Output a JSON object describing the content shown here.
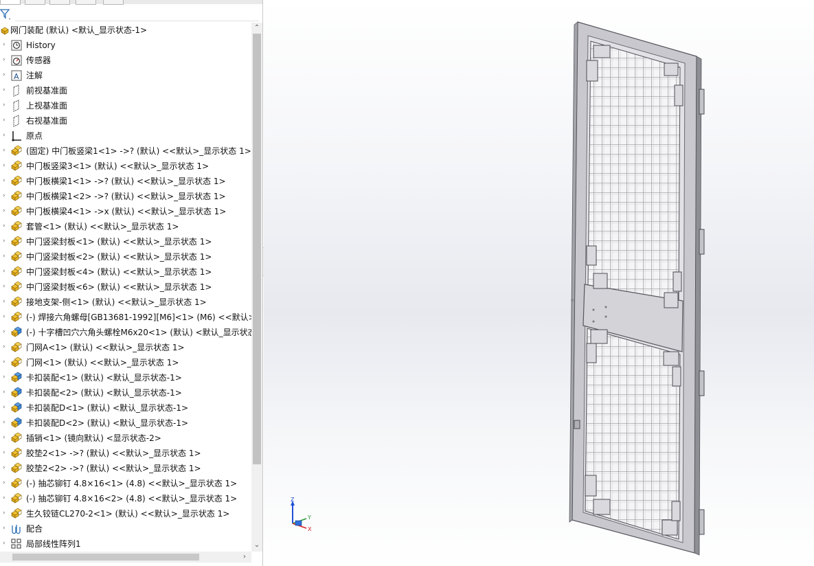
{
  "feature_tree": {
    "root_label": "网门装配 (默认) <默认_显示状态-1>",
    "items": [
      {
        "label": "History",
        "icon": "history-icon"
      },
      {
        "label": "传感器",
        "icon": "sensor-icon"
      },
      {
        "label": "注解",
        "icon": "annotation-icon"
      },
      {
        "label": "前视基准面",
        "icon": "plane-icon"
      },
      {
        "label": "上视基准面",
        "icon": "plane-icon"
      },
      {
        "label": "右视基准面",
        "icon": "plane-icon"
      },
      {
        "label": "原点",
        "icon": "origin-icon"
      },
      {
        "label": "(固定) 中门板竖梁1<1> ->? (默认) <<默认>_显示状态 1>",
        "icon": "part-icon"
      },
      {
        "label": "中门板竖梁3<1> (默认) <<默认>_显示状态 1>",
        "icon": "part-icon"
      },
      {
        "label": "中门板横梁1<1> ->? (默认) <<默认>_显示状态 1>",
        "icon": "part-icon"
      },
      {
        "label": "中门板横梁1<2> ->? (默认) <<默认>_显示状态 1>",
        "icon": "part-icon"
      },
      {
        "label": "中门板横梁4<1> ->x (默认) <<默认>_显示状态 1>",
        "icon": "part-icon"
      },
      {
        "label": "套管<1> (默认) <<默认>_显示状态 1>",
        "icon": "part-icon"
      },
      {
        "label": "中门竖梁封板<1> (默认) <<默认>_显示状态 1>",
        "icon": "part-icon"
      },
      {
        "label": "中门竖梁封板<2> (默认) <<默认>_显示状态 1>",
        "icon": "part-icon"
      },
      {
        "label": "中门竖梁封板<4> (默认) <<默认>_显示状态 1>",
        "icon": "part-icon"
      },
      {
        "label": "中门竖梁封板<6> (默认) <<默认>_显示状态 1>",
        "icon": "part-icon"
      },
      {
        "label": "接地支架-侧<1> (默认) <<默认>_显示状态 1>",
        "icon": "part-icon"
      },
      {
        "label": "(-) 焊接六角螺母[GB13681-1992][M6]<1> (M6) <<默认>",
        "icon": "part-icon"
      },
      {
        "label": "(-) 十字槽凹穴六角头螺栓M6x20<1> (默认) <默认_显示状态",
        "icon": "subassembly-icon"
      },
      {
        "label": "门网A<1> (默认) <<默认>_显示状态 1>",
        "icon": "part-icon"
      },
      {
        "label": "门网<1> (默认) <<默认>_显示状态 1>",
        "icon": "part-icon"
      },
      {
        "label": "卡扣装配<1> (默认) <默认_显示状态-1>",
        "icon": "subassembly-icon"
      },
      {
        "label": "卡扣装配<2> (默认) <默认_显示状态-1>",
        "icon": "subassembly-icon"
      },
      {
        "label": "卡扣装配D<1> (默认) <默认_显示状态-1>",
        "icon": "subassembly-icon"
      },
      {
        "label": "卡扣装配D<2> (默认) <默认_显示状态-1>",
        "icon": "subassembly-icon"
      },
      {
        "label": "插销<1> (镜向默认) <显示状态-2>",
        "icon": "part-icon"
      },
      {
        "label": "胶垫2<1> ->? (默认) <<默认>_显示状态 1>",
        "icon": "part-icon"
      },
      {
        "label": "胶垫2<2> ->? (默认) <<默认>_显示状态 1>",
        "icon": "part-icon"
      },
      {
        "label": "(-) 抽芯铆钉 4.8×16<1> (4.8) <<默认>_显示状态 1>",
        "icon": "part-icon"
      },
      {
        "label": "(-) 抽芯铆钉 4.8×16<2> (4.8) <<默认>_显示状态 1>",
        "icon": "part-icon"
      },
      {
        "label": "生久铰链CL270-2<1> (默认) <<默认>_显示状态 1>",
        "icon": "part-icon"
      },
      {
        "label": "配合",
        "icon": "mates-icon"
      },
      {
        "label": "局部线性阵列1",
        "icon": "pattern-icon"
      }
    ]
  },
  "triad": {
    "z": "Z",
    "y": "Y",
    "x": "X"
  },
  "colors": {
    "part_yellow": "#f2c12e",
    "subassembly_blue": "#3c8ad8",
    "frame_gray": "#b9b9c0",
    "mesh_gray": "#8a8a90"
  }
}
